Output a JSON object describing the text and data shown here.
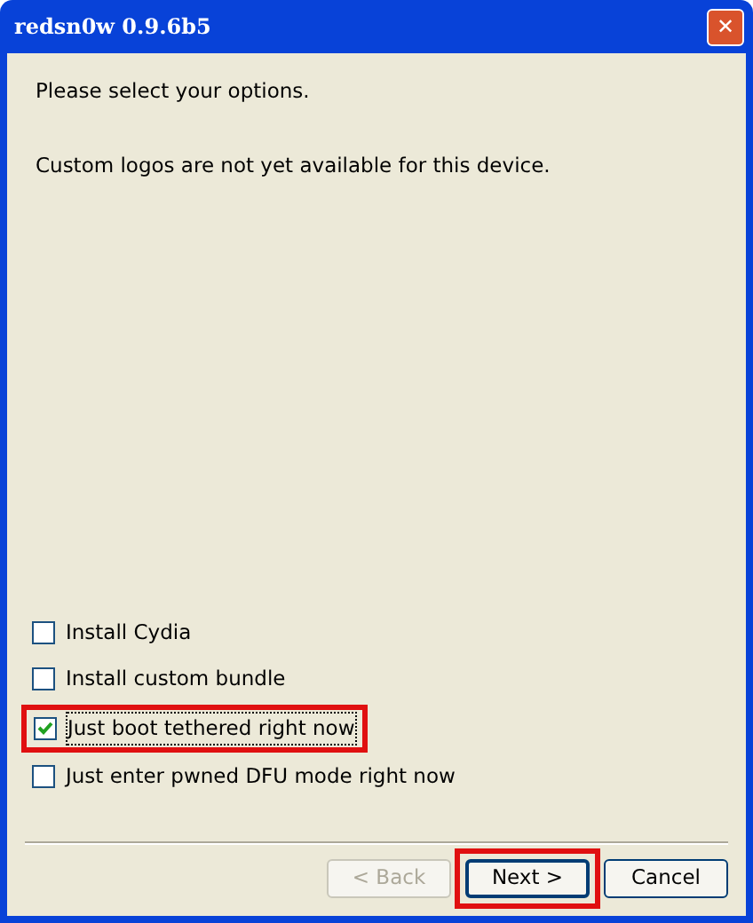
{
  "window": {
    "title": "redsn0w 0.9.6b5",
    "close": "✕"
  },
  "messages": [
    "Please select your options.",
    "Custom logos are not yet available for this device."
  ],
  "options": [
    {
      "label": "Install Cydia",
      "checked": false,
      "highlighted": false,
      "focused": false
    },
    {
      "label": "Install custom bundle",
      "checked": false,
      "highlighted": false,
      "focused": false
    },
    {
      "label": "Just boot tethered right now",
      "checked": true,
      "highlighted": true,
      "focused": true
    },
    {
      "label": "Just enter pwned DFU mode right now",
      "checked": false,
      "highlighted": false,
      "focused": false
    }
  ],
  "buttons": [
    {
      "label": "< Back",
      "disabled": true,
      "default": false,
      "highlighted": false
    },
    {
      "label": "Next >",
      "disabled": false,
      "default": true,
      "highlighted": true
    },
    {
      "label": "Cancel",
      "disabled": false,
      "default": false,
      "highlighted": false
    }
  ]
}
